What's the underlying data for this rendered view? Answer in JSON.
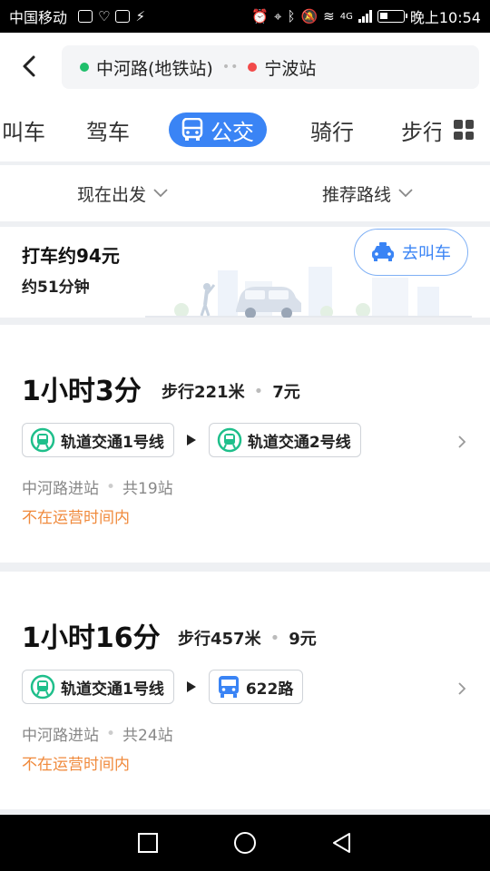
{
  "status_bar": {
    "carrier": "中国移动",
    "network": "4G",
    "time": "晚上10:54"
  },
  "route": {
    "origin": "中河路(地铁站)",
    "destination": "宁波站",
    "separator": "••"
  },
  "tabs": [
    {
      "label": "叫车",
      "state": "partial"
    },
    {
      "label": "驾车",
      "state": "normal"
    },
    {
      "label": "公交",
      "state": "active"
    },
    {
      "label": "骑行",
      "state": "normal"
    },
    {
      "label": "步行",
      "state": "partial"
    }
  ],
  "filters": {
    "departure": "现在出发",
    "sort": "推荐路线"
  },
  "taxi": {
    "price_text": "打车约94元",
    "time_text": "约51分钟",
    "button_label": "去叫车"
  },
  "routes": [
    {
      "duration": "1小时3分",
      "walk": "步行221米",
      "price": "7元",
      "segments": [
        {
          "type": "metro",
          "label": "轨道交通1号线"
        },
        {
          "type": "metro",
          "label": "轨道交通2号线"
        }
      ],
      "boarding": "中河路进站",
      "stops": "共19站",
      "notice": "不在运营时间内"
    },
    {
      "duration": "1小时16分",
      "walk": "步行457米",
      "price": "9元",
      "segments": [
        {
          "type": "metro",
          "label": "轨道交通1号线"
        },
        {
          "type": "bus",
          "label": "622路"
        }
      ],
      "boarding": "中河路进站",
      "stops": "共24站",
      "notice": "不在运营时间内"
    }
  ],
  "colors": {
    "accent": "#3a84f5",
    "origin_dot": "#1fbf6b",
    "destination_dot": "#f24a4a",
    "metro_icon": "#1fbf8b",
    "bus_icon": "#3a84f5",
    "notice": "#f08a3c"
  }
}
